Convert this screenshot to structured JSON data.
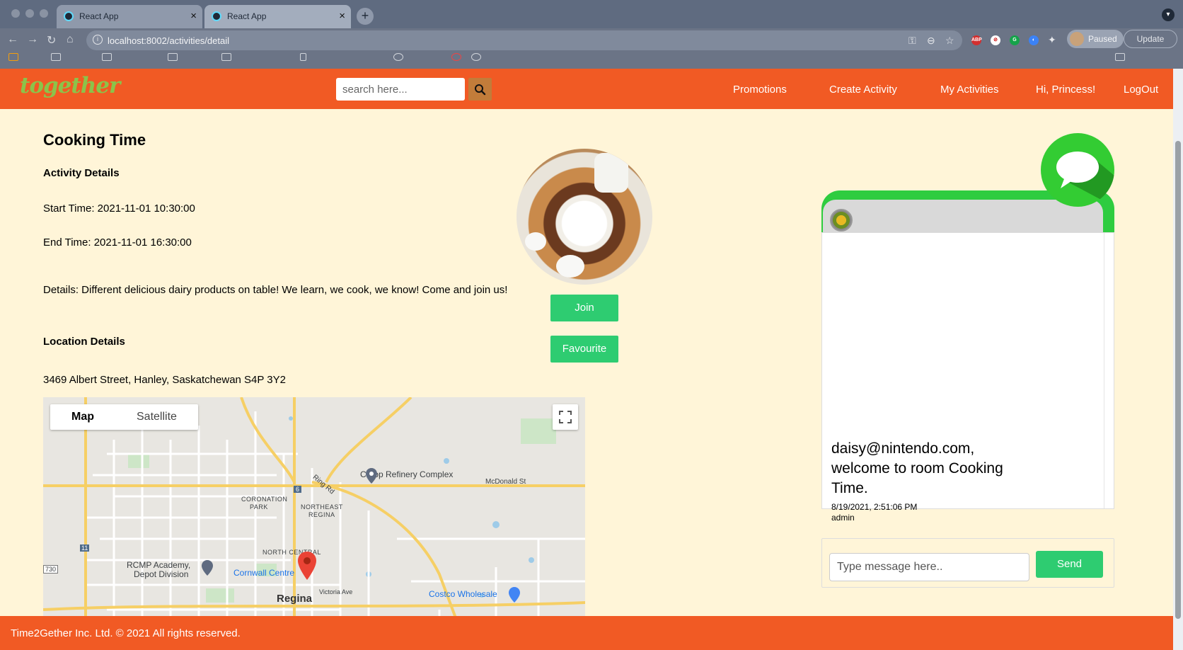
{
  "browser": {
    "tabs": [
      {
        "title": "React App",
        "active": false
      },
      {
        "title": "React App",
        "active": true
      }
    ],
    "url": "localhost:8002/activities/detail",
    "profile_status": "Paused",
    "update_label": "Update"
  },
  "nav": {
    "logo": "together",
    "search_placeholder": "search here...",
    "links": [
      "Promotions",
      "Create Activity",
      "My Activities",
      "Hi, Princess!",
      "LogOut"
    ],
    "brand_color": "#f15a24"
  },
  "activity": {
    "title": "Cooking Time",
    "details_heading": "Activity Details",
    "start": "Start Time: 2021-11-01 10:30:00",
    "end": "End Time: 2021-11-01 16:30:00",
    "details": "Details: Different delicious dairy products on table! We learn, we cook, we know! Come and join us!",
    "location_heading": "Location Details",
    "address": "3469 Albert Street, Hanley, Saskatchewan S4P 3Y2",
    "join_label": "Join",
    "favourite_label": "Favourite"
  },
  "map": {
    "map_label": "Map",
    "satellite_label": "Satellite",
    "labels": {
      "coop": "Co-op Refinery Complex",
      "mcdonald": "McDonald St",
      "ring": "Ring Rd",
      "coronation1": "CORONATION",
      "coronation2": "PARK",
      "northeast1": "NORTHEAST",
      "northeast2": "REGINA",
      "northcentral": "NORTH CENTRAL",
      "rcmp1": "RCMP Academy,",
      "rcmp2": "Depot Division",
      "cornwall": "Cornwall Centre",
      "victoria": "Victoria Ave",
      "costco": "Costco Wholesale",
      "regina": "Regina",
      "hwy6": "6",
      "hwy11": "11",
      "hwy730": "730"
    }
  },
  "chat": {
    "message": "daisy@nintendo.com, welcome to room Cooking Time.",
    "timestamp": "8/19/2021, 2:51:06 PM",
    "sender": "admin",
    "input_placeholder": "Type message here..",
    "send_label": "Send"
  },
  "footer": {
    "text": "Time2Gether Inc. Ltd. © 2021 All rights reserved."
  }
}
